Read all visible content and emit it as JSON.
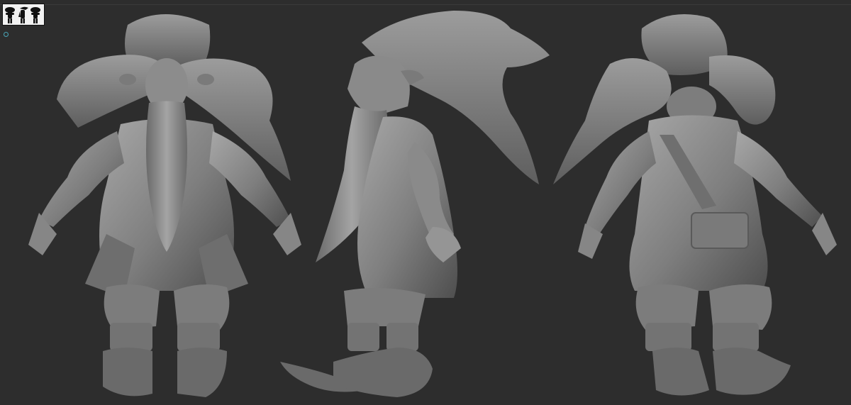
{
  "app": {
    "background": "#2d2d2d"
  },
  "viewport": {
    "views": [
      {
        "name": "front"
      },
      {
        "name": "side"
      },
      {
        "name": "back"
      }
    ],
    "thumbnail_icon": "three-view-silhouettes-icon",
    "axis_icon": "axis-circle-icon"
  },
  "colors": {
    "sculpt": "#8a8a8a",
    "sculpt_shadow": "#5c5c5c",
    "sculpt_highlight": "#b0b0b0"
  }
}
